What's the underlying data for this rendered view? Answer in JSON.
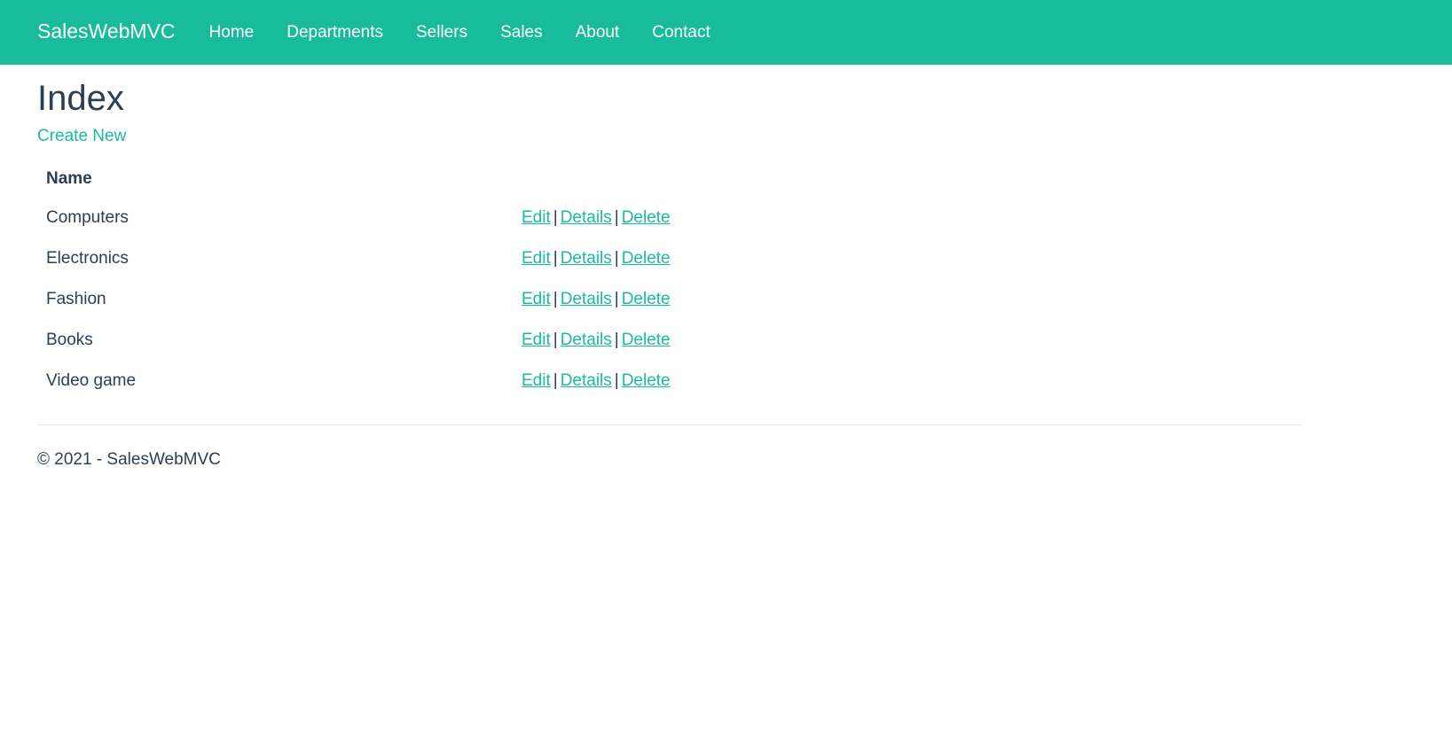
{
  "nav": {
    "brand": "SalesWebMVC",
    "items": [
      {
        "label": "Home"
      },
      {
        "label": "Departments"
      },
      {
        "label": "Sellers"
      },
      {
        "label": "Sales"
      },
      {
        "label": "About"
      },
      {
        "label": "Contact"
      }
    ]
  },
  "page": {
    "title": "Index",
    "create_new": "Create New"
  },
  "table": {
    "header": {
      "name": "Name"
    },
    "actions": {
      "edit": "Edit",
      "details": "Details",
      "delete": "Delete",
      "separator": "|"
    },
    "rows": [
      {
        "name": "Computers"
      },
      {
        "name": "Electronics"
      },
      {
        "name": "Fashion"
      },
      {
        "name": "Books"
      },
      {
        "name": "Video game"
      }
    ]
  },
  "footer": {
    "text": "© 2021 - SalesWebMVC"
  },
  "colors": {
    "accent": "#18bc9c",
    "text": "#2c3e50"
  }
}
